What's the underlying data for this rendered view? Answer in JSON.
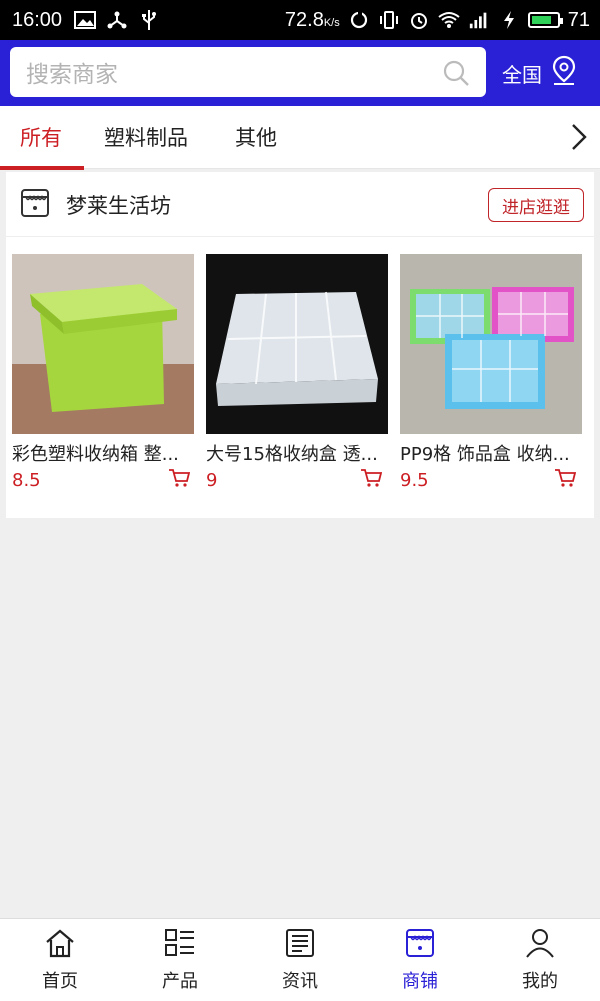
{
  "status_bar": {
    "time": "16:00",
    "speed": "72.8",
    "speed_unit": "K/s",
    "battery_level": "71",
    "icons_left": [
      "image-icon",
      "share-icon",
      "usb-icon"
    ],
    "icons_right": [
      "sync-icon",
      "vibrate-icon",
      "alarm-icon",
      "wifi-icon",
      "signal-4g-icon",
      "charging-icon",
      "battery-icon"
    ]
  },
  "search": {
    "placeholder": "搜索商家",
    "region_label": "全国"
  },
  "tabs": [
    {
      "label": "所有",
      "active": true
    },
    {
      "label": "塑料制品",
      "active": false
    },
    {
      "label": "其他",
      "active": false
    }
  ],
  "shop": {
    "name": "梦莱生活坊",
    "visit_label": "进店逛逛"
  },
  "products": [
    {
      "title": "彩色塑料收纳箱 整...",
      "price": "8.5"
    },
    {
      "title": "大号15格收纳盒 透...",
      "price": "9"
    },
    {
      "title": "PP9格 饰品盒 收纳...",
      "price": "9.5"
    }
  ],
  "bottom_nav": [
    {
      "label": "首页",
      "icon": "home-icon"
    },
    {
      "label": "产品",
      "icon": "grid-list-icon"
    },
    {
      "label": "资讯",
      "icon": "news-icon"
    },
    {
      "label": "商铺",
      "icon": "store-icon",
      "active": true
    },
    {
      "label": "我的",
      "icon": "user-icon"
    }
  ],
  "colors": {
    "accent_blue": "#2a20d6",
    "accent_red": "#cc1f24",
    "background": "#efefef"
  }
}
